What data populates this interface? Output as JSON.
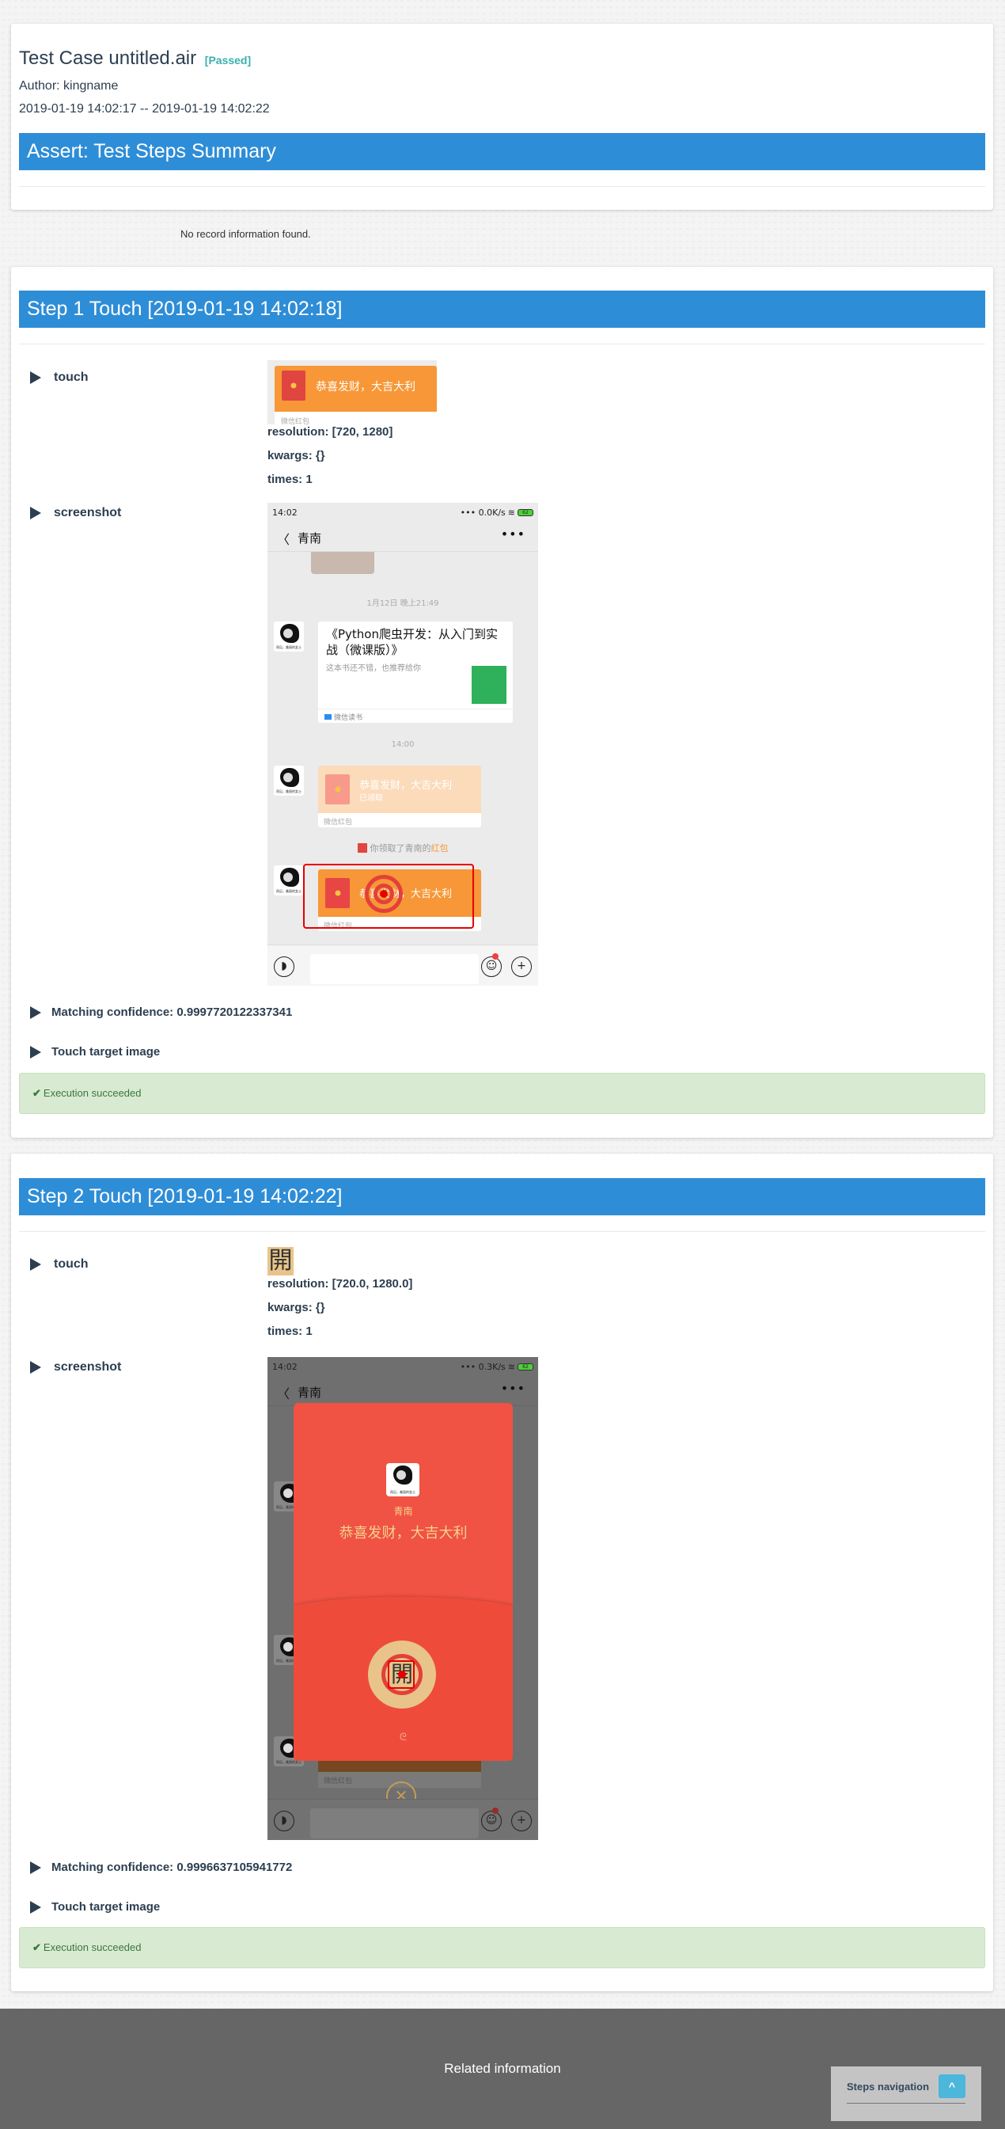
{
  "summary": {
    "title": "Test Case untitled.air",
    "status": "[Passed]",
    "author": "Author: kingname",
    "time_range": "2019-01-19 14:02:17 -- 2019-01-19 14:02:22",
    "assert_header": "Assert: Test Steps Summary"
  },
  "no_record": "No record information found.",
  "steps": [
    {
      "header": "Step 1 Touch [2019-01-19 14:02:18]",
      "touch_label": "touch",
      "resolution": "resolution: [720, 1280]",
      "kwargs": "kwargs: {}",
      "times": "times: 1",
      "screenshot_label": "screenshot",
      "confidence": "Matching confidence: 0.9997720122337341",
      "target_label": "Touch target image",
      "result": "Execution succeeded",
      "target_image": {
        "message": "恭喜发财，大吉大利",
        "footer": "微信红包"
      },
      "phone": {
        "time": "14:02",
        "status_right": "••• 0.0K/s",
        "battery": "62",
        "back": "〈",
        "contact": "青南",
        "more": "•••",
        "timestamp1": "1月12日 晚上21:49",
        "card_title": "《Python爬虫开发：从入门到实战（微课版）》",
        "card_desc": "这本书还不错，也推荐给你",
        "card_source": "微信读书",
        "timestamp2": "14:00",
        "packet1_msg": "恭喜发财，大吉大利",
        "packet1_sub": "已领取",
        "packet_footer": "微信红包",
        "notice_prefix": "你领取了青南的",
        "notice_link": "红包",
        "packet2_msg": "恭喜发财，大吉大利",
        "avatar_caption": "再见，美丽的女士"
      }
    },
    {
      "header": "Step 2 Touch [2019-01-19 14:02:22]",
      "touch_label": "touch",
      "target_glyph": "開",
      "resolution": "resolution: [720.0, 1280.0]",
      "kwargs": "kwargs: {}",
      "times": "times: 1",
      "screenshot_label": "screenshot",
      "confidence": "Matching confidence: 0.9996637105941772",
      "target_label": "Touch target image",
      "result": "Execution succeeded",
      "phone": {
        "time": "14:02",
        "status_right": "••• 0.3K/s",
        "battery": "62",
        "back": "〈",
        "contact": "青南",
        "more": "•••",
        "popup_name": "青南",
        "popup_msg": "恭喜发财，大吉大利",
        "open_glyph": "開",
        "swirl": "ᘓ",
        "close": "✕",
        "packet_footer": "微信红包",
        "avatar_caption": "再见，美丽的女士"
      }
    }
  ],
  "footer": {
    "related": "Related information",
    "steps_nav": "Steps navigation",
    "up_icon": "^"
  },
  "colors": {
    "header_blue": "#2e8dd7",
    "passed": "#3ab0b0",
    "success_bg": "#d8ead2",
    "success_text": "#3c763d",
    "packet_orange": "#f79737",
    "popup_red": "#f05243"
  }
}
